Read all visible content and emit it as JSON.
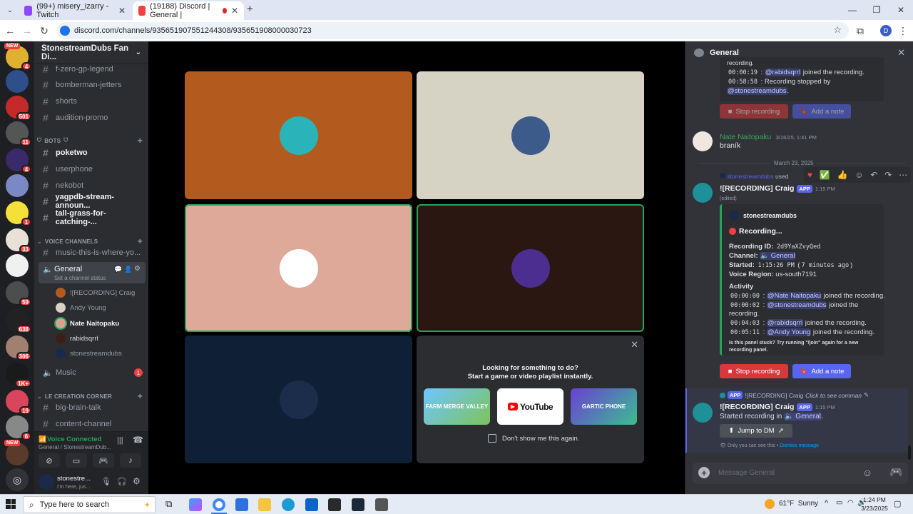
{
  "browser": {
    "tabs": [
      {
        "title": "(99+) misery_izarry - Twitch",
        "active": false,
        "color": "#9146ff"
      },
      {
        "title": "(19188) Discord | General | ",
        "active": true,
        "color": "#5865f2"
      }
    ],
    "new_tab": "+",
    "url": "discord.com/channels/935651907551244308/935651908000030723",
    "profile_initial": "D"
  },
  "server_list": {
    "new_label": "NEW",
    "badges": [
      "4",
      "",
      "501",
      "11",
      "4",
      "",
      "1",
      "33",
      "",
      "59",
      "638",
      "306",
      "1K+",
      "19",
      "6",
      ""
    ],
    "new_label2": "NEW"
  },
  "guild": {
    "name": "StonestreamDubs Fan Di...",
    "channels_top": [
      "f-zero-gp-legend",
      "bomberman-jetters",
      "shorts",
      "audition-promo"
    ],
    "bots_category": "BOTS",
    "bot_channels": [
      {
        "name": "poketwo",
        "bold": true
      },
      {
        "name": "userphone",
        "bold": false
      },
      {
        "name": "nekobot",
        "bold": false
      },
      {
        "name": "yagpdb-stream-announ...",
        "bold": true
      },
      {
        "name": "tall-grass-for-catching-...",
        "bold": true
      }
    ],
    "voice_category": "VOICE CHANNELS",
    "voice_text_channel": "music-this-is-where-yo...",
    "voice_channel": "General",
    "channel_status": "Set a channel status",
    "voice_users": [
      {
        "name": "![RECORDING] Craig",
        "color": "#b35a1f",
        "bold": false
      },
      {
        "name": "Andy Young",
        "color": "#d6d2c4",
        "bold": false
      },
      {
        "name": "Nate Naitopaku",
        "color": "#d9a090",
        "bold": true
      },
      {
        "name": "rabidsqrrl",
        "color": "#3d1f16",
        "bold": false
      },
      {
        "name": "stonestreamdubs",
        "color": "#1a2a4a",
        "bold": false
      }
    ],
    "music_channel": "Music",
    "music_badge": "1",
    "creation_category": "LE CREATION CORNER",
    "creation_channels": [
      "big-brain-talk",
      "content-channel"
    ]
  },
  "voice_status": {
    "title": "Voice Connected",
    "subtitle": "General / StonestreamDub..."
  },
  "user": {
    "name": "stonestre...",
    "status": "I'm here, jus..."
  },
  "tiles": [
    {
      "bg": "#b35a1f",
      "avatar": "#2ab3b8",
      "speaking": false
    },
    {
      "bg": "#d6d2c4",
      "avatar": "#3c5a8a",
      "speaking": false
    },
    {
      "bg": "#dfa999",
      "avatar": "#ffffff",
      "speaking": true
    },
    {
      "bg": "#2a1712",
      "avatar": "#4b2e8f",
      "speaking": true
    },
    {
      "bg": "#0f2036",
      "avatar": "#1b2d4a",
      "speaking": false
    }
  ],
  "promo": {
    "line1": "Looking for something to do?",
    "line2": "Start a game or video playlist instantly.",
    "activities": [
      "FARM MERGE VALLEY",
      "YouTube",
      "GARTIC PHONE"
    ],
    "checkbox_label": "Don't show me this again."
  },
  "panel": {
    "title": "General",
    "prior_activity": [
      {
        "time": "00:00:19",
        "mention": "@rabidsqrrl",
        "text": " joined the recording."
      },
      {
        "time": "00:58:58",
        "mention": "",
        "text": " Recording stopped by"
      }
    ],
    "prior_mention": "@stonestreamdubs",
    "prior_text_top": "recording.",
    "stop_recording": "Stop recording",
    "add_note": "Add a note",
    "msg1": {
      "author": "Nate Naitopaku",
      "time": "3/16/25, 1:41 PM",
      "text": "braník"
    },
    "date_divider": "March 23, 2025",
    "msg2": {
      "used_by": "stonestreamdubs",
      "used_word": "used",
      "author": "![RECORDING] Craig",
      "app_tag": "APP",
      "time": "1:15 PM",
      "edited": "(edited)",
      "embed_author": "stonestreamdubs",
      "embed_title": "Recording...",
      "fields": [
        {
          "label": "Recording ID:",
          "value": "2d9YaXZvyQed"
        },
        {
          "label": "Channel:",
          "value": "General"
        },
        {
          "label": "Started:",
          "value": "1:15:26 PM",
          "extra": "7 minutes ago"
        },
        {
          "label": "Voice Region:",
          "value": "us-south7191"
        }
      ],
      "activity_title": "Activity",
      "activity": [
        {
          "time": "00:00:00",
          "mention": "@Nate Naitopaku",
          "text": " joined the recording."
        },
        {
          "time": "00:00:02",
          "mention": "@stonestreamdubs",
          "text": " joined the"
        },
        {
          "time": "00:04:03",
          "mention": "@rabidsqrrl",
          "text": " joined the recording."
        },
        {
          "time": "00:05:11",
          "mention": "@Andy Young",
          "text": " joined the recording."
        }
      ],
      "wrap_word": "recording.",
      "footer_note": "Is this panel stuck? Try running \"/join\" again for a new recording panel."
    },
    "msg3": {
      "reply_author": "![RECORDING] Craig",
      "reply_text": "Click to see comman",
      "author": "![RECORDING] Craig",
      "time": "1:15 PM",
      "text_prefix": "Started recording in",
      "channel": "General",
      "jump": "Jump to DM",
      "ephemeral": "Only you can see this",
      "dismiss": "Dismiss message"
    },
    "input_placeholder": "Message General"
  },
  "taskbar": {
    "search_placeholder": "Type here to search",
    "weather": "61°F  Sunny",
    "time": "1:24 PM",
    "date": "3/23/2025"
  }
}
